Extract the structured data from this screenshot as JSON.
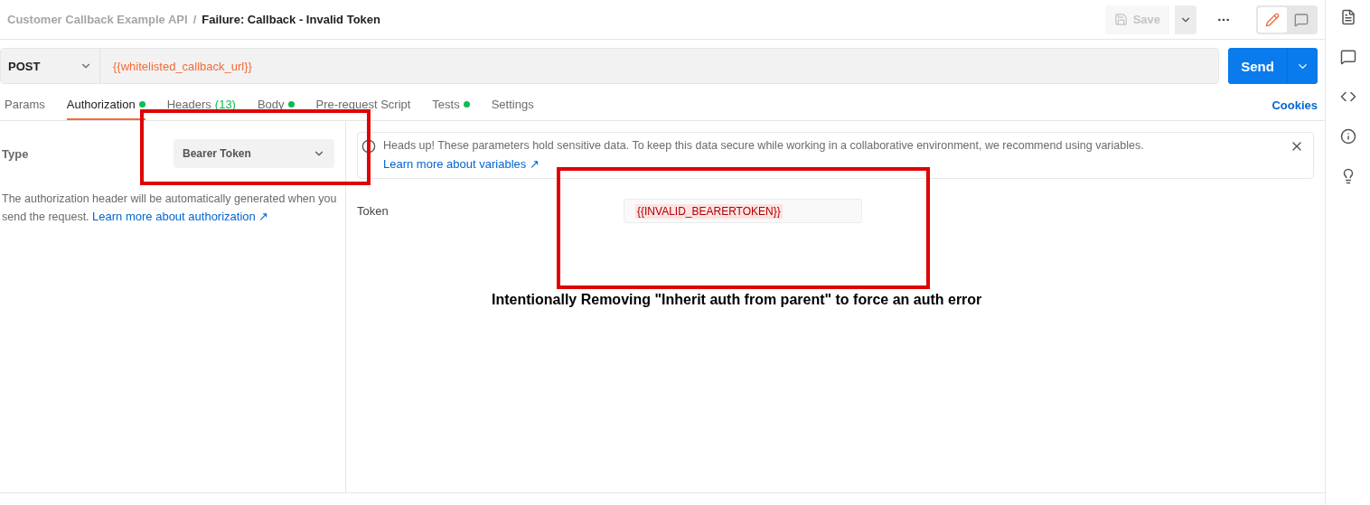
{
  "breadcrumb": {
    "collection": "Customer Callback Example API",
    "separator": "/",
    "request": "Failure: Callback - Invalid Token"
  },
  "toolbar": {
    "save": {
      "label": "Save",
      "disabled": true
    },
    "mode": [
      {
        "kind": "edit",
        "selected": true
      },
      {
        "kind": "comment",
        "selected": false
      }
    ]
  },
  "request": {
    "method": "POST",
    "url": "{{whitelisted_callback_url}}",
    "send": "Send"
  },
  "tabs": [
    {
      "label": "Params",
      "dot": false,
      "selected": false
    },
    {
      "label": "Authorization",
      "dot": true,
      "selected": true
    },
    {
      "label": "Headers",
      "count": "(13)",
      "dot": false,
      "selected": false
    },
    {
      "label": "Body",
      "dot": true,
      "selected": false
    },
    {
      "label": "Pre-request Script",
      "dot": false,
      "selected": false
    },
    {
      "label": "Tests",
      "dot": true,
      "selected": false
    },
    {
      "label": "Settings",
      "dot": false,
      "selected": false
    }
  ],
  "cookies": "Cookies",
  "auth": {
    "type_label": "Type",
    "type_value": "Bearer Token",
    "description": "The authorization header will be automatically generated when you send the request.",
    "learn_more": "Learn more about authorization ↗"
  },
  "notice": {
    "text": "Heads up! These parameters hold sensitive data. To keep this data secure while working in a collaborative environment, we recommend using variables.",
    "link": "Learn more about variables ↗"
  },
  "token": {
    "label": "Token",
    "value": "{{INVALID_BEARERTOKEN}}"
  },
  "annotation": "Intentionally Removing \"Inherit auth from parent\" to force an auth error",
  "sidebar": [
    {
      "kind": "docs"
    },
    {
      "kind": "comments"
    },
    {
      "kind": "code"
    },
    {
      "kind": "info"
    },
    {
      "kind": "idea"
    }
  ]
}
